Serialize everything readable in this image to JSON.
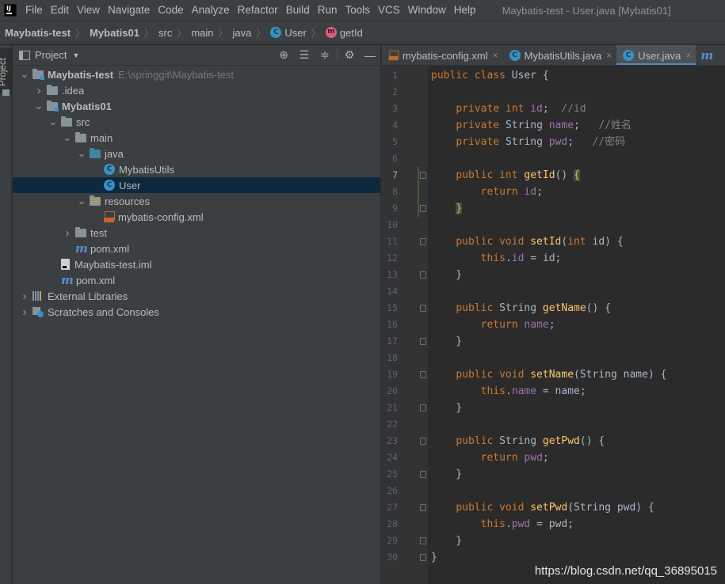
{
  "menu": {
    "items": [
      "File",
      "Edit",
      "View",
      "Navigate",
      "Code",
      "Analyze",
      "Refactor",
      "Build",
      "Run",
      "Tools",
      "VCS",
      "Window",
      "Help"
    ],
    "window_title": "Maybatis-test - User.java [Mybatis01]"
  },
  "breadcrumb": {
    "project": "Maybatis-test",
    "module": "Mybatis01",
    "src": "src",
    "main": "main",
    "java": "java",
    "class": "User",
    "method": "getId"
  },
  "tool_stripe": {
    "project_label": "Project"
  },
  "project_panel": {
    "title": "Project",
    "tree": [
      {
        "label": "Maybatis-test",
        "hint": "E:\\springgit\\Maybatis-test",
        "level": 0,
        "arrow": "open",
        "icon": "module-folder-icon",
        "bold": true
      },
      {
        "label": ".idea",
        "level": 1,
        "arrow": "closed",
        "icon": "folder-icon"
      },
      {
        "label": "Mybatis01",
        "level": 1,
        "arrow": "open",
        "icon": "module-folder-icon",
        "bold": true
      },
      {
        "label": "src",
        "level": 2,
        "arrow": "open",
        "icon": "folder-icon"
      },
      {
        "label": "main",
        "level": 3,
        "arrow": "open",
        "icon": "folder-icon"
      },
      {
        "label": "java",
        "level": 4,
        "arrow": "open",
        "icon": "source-folder-icon"
      },
      {
        "label": "MybatisUtils",
        "level": 5,
        "arrow": "none",
        "icon": "java-class-icon"
      },
      {
        "label": "User",
        "level": 5,
        "arrow": "none",
        "icon": "java-class-icon",
        "selected": true
      },
      {
        "label": "resources",
        "level": 4,
        "arrow": "open",
        "icon": "resources-folder-icon"
      },
      {
        "label": "mybatis-config.xml",
        "level": 5,
        "arrow": "none",
        "icon": "xml-file-icon"
      },
      {
        "label": "test",
        "level": 3,
        "arrow": "closed",
        "icon": "folder-icon"
      },
      {
        "label": "pom.xml",
        "level": 3,
        "arrow": "none",
        "icon": "maven-icon"
      },
      {
        "label": "Maybatis-test.iml",
        "level": 2,
        "arrow": "none",
        "icon": "iml-file-icon"
      },
      {
        "label": "pom.xml",
        "level": 2,
        "arrow": "none",
        "icon": "maven-icon"
      },
      {
        "label": "External Libraries",
        "level": 0,
        "arrow": "closed",
        "icon": "library-icon"
      },
      {
        "label": "Scratches and Consoles",
        "level": 0,
        "arrow": "closed",
        "icon": "scratches-icon"
      }
    ]
  },
  "editor": {
    "tabs": [
      {
        "label": "mybatis-config.xml",
        "icon": "xml-file-icon",
        "active": false
      },
      {
        "label": "MybatisUtils.java",
        "icon": "java-class-icon",
        "active": false
      },
      {
        "label": "User.java",
        "icon": "java-class-icon",
        "active": true
      }
    ],
    "tab_overflow_icon": "maven-icon",
    "current_line": 7,
    "lines": [
      [
        [
          "kw",
          "public class "
        ],
        [
          "t",
          "User {"
        ]
      ],
      [],
      [
        [
          "t",
          "    "
        ],
        [
          "kw",
          "private int "
        ],
        [
          "fld",
          "id"
        ],
        [
          "t",
          ";  "
        ],
        [
          "cm",
          "//id"
        ]
      ],
      [
        [
          "t",
          "    "
        ],
        [
          "kw",
          "private "
        ],
        [
          "t",
          "String "
        ],
        [
          "fld",
          "name"
        ],
        [
          "t",
          ";   "
        ],
        [
          "cm",
          "//姓名"
        ]
      ],
      [
        [
          "t",
          "    "
        ],
        [
          "kw",
          "private "
        ],
        [
          "t",
          "String "
        ],
        [
          "fld",
          "pwd"
        ],
        [
          "t",
          ";   "
        ],
        [
          "cm",
          "//密码"
        ]
      ],
      [],
      [
        [
          "t",
          "    "
        ],
        [
          "kw",
          "public int "
        ],
        [
          "fn",
          "getId"
        ],
        [
          "t",
          "() "
        ],
        [
          "br",
          "{"
        ]
      ],
      [
        [
          "t",
          "        "
        ],
        [
          "kw",
          "return "
        ],
        [
          "fld",
          "id"
        ],
        [
          "t",
          ";"
        ]
      ],
      [
        [
          "t",
          "    "
        ],
        [
          "br",
          "}"
        ]
      ],
      [],
      [
        [
          "t",
          "    "
        ],
        [
          "kw",
          "public void "
        ],
        [
          "fn",
          "setId"
        ],
        [
          "t",
          "("
        ],
        [
          "kw",
          "int "
        ],
        [
          "t",
          "id) {"
        ]
      ],
      [
        [
          "t",
          "        "
        ],
        [
          "kw",
          "this"
        ],
        [
          "t",
          "."
        ],
        [
          "fld",
          "id"
        ],
        [
          "t",
          " = id;"
        ]
      ],
      [
        [
          "t",
          "    }"
        ]
      ],
      [],
      [
        [
          "t",
          "    "
        ],
        [
          "kw",
          "public "
        ],
        [
          "t",
          "String "
        ],
        [
          "fn",
          "getName"
        ],
        [
          "t",
          "() {"
        ]
      ],
      [
        [
          "t",
          "        "
        ],
        [
          "kw",
          "return "
        ],
        [
          "fld",
          "name"
        ],
        [
          "t",
          ";"
        ]
      ],
      [
        [
          "t",
          "    }"
        ]
      ],
      [],
      [
        [
          "t",
          "    "
        ],
        [
          "kw",
          "public void "
        ],
        [
          "fn",
          "setName"
        ],
        [
          "t",
          "(String name) {"
        ]
      ],
      [
        [
          "t",
          "        "
        ],
        [
          "kw",
          "this"
        ],
        [
          "t",
          "."
        ],
        [
          "fld",
          "name"
        ],
        [
          "t",
          " = name;"
        ]
      ],
      [
        [
          "t",
          "    }"
        ]
      ],
      [],
      [
        [
          "t",
          "    "
        ],
        [
          "kw",
          "public "
        ],
        [
          "t",
          "String "
        ],
        [
          "fn",
          "getPwd"
        ],
        [
          "t",
          "() {"
        ]
      ],
      [
        [
          "t",
          "        "
        ],
        [
          "kw",
          "return "
        ],
        [
          "fld",
          "pwd"
        ],
        [
          "t",
          ";"
        ]
      ],
      [
        [
          "t",
          "    }"
        ]
      ],
      [],
      [
        [
          "t",
          "    "
        ],
        [
          "kw",
          "public void "
        ],
        [
          "fn",
          "setPwd"
        ],
        [
          "t",
          "(String pwd) {"
        ]
      ],
      [
        [
          "t",
          "        "
        ],
        [
          "kw",
          "this"
        ],
        [
          "t",
          "."
        ],
        [
          "fld",
          "pwd"
        ],
        [
          "t",
          " = pwd;"
        ]
      ],
      [
        [
          "t",
          "    }"
        ]
      ],
      [
        [
          "t",
          "}"
        ]
      ]
    ]
  },
  "watermark": "https://blog.csdn.net/qq_36895015",
  "colors": {
    "keyword": "#cc7832",
    "field": "#9876aa",
    "method": "#ffc66d",
    "comment": "#808080",
    "text": "#a9b7c6",
    "selection": "#0d293e",
    "class_icon": "#3592c4"
  }
}
